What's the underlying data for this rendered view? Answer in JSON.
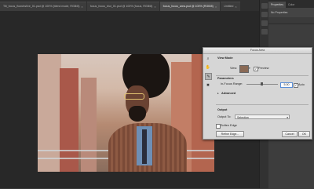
{
  "tabs": [
    {
      "label": "Tilt_focus_flowchsfive_01.psd @ 100% (blend mode, RGB/8)",
      "active": false
    },
    {
      "label": "focus_focus_blur_01.psd @ 100% (focus, RGB/8)",
      "active": false
    },
    {
      "label": "focus_focus_area.psd @ 100% (RGB/8)",
      "active": true
    },
    {
      "label": "Untitled",
      "active": false
    }
  ],
  "tab_close_glyph": "×",
  "panel": {
    "tabs": [
      "Properties",
      "Color"
    ],
    "message": "No Properties"
  },
  "dialog": {
    "title": "Focus Area",
    "view_mode_heading": "View Mode",
    "view_label": "View:",
    "preview_label": "Preview",
    "preview_checked": true,
    "parameters_heading": "Parameters",
    "in_focus_range_label": "In-Focus Range:",
    "in_focus_value": "5.00",
    "in_focus_slider_fraction": 0.45,
    "auto_label": "Auto",
    "auto_checked": true,
    "advanced_label": "Advanced",
    "output_heading": "Output",
    "output_to_label": "Output To:",
    "output_to_value": "Selection",
    "soften_edge_label": "Soften Edge",
    "soften_edge_checked": false,
    "refine_edge_label": "Refine Edge...",
    "cancel_label": "Cancel",
    "ok_label": "OK",
    "check_glyph": "✓",
    "expand_glyph": "▸",
    "dropdown_glyph": "▾"
  }
}
